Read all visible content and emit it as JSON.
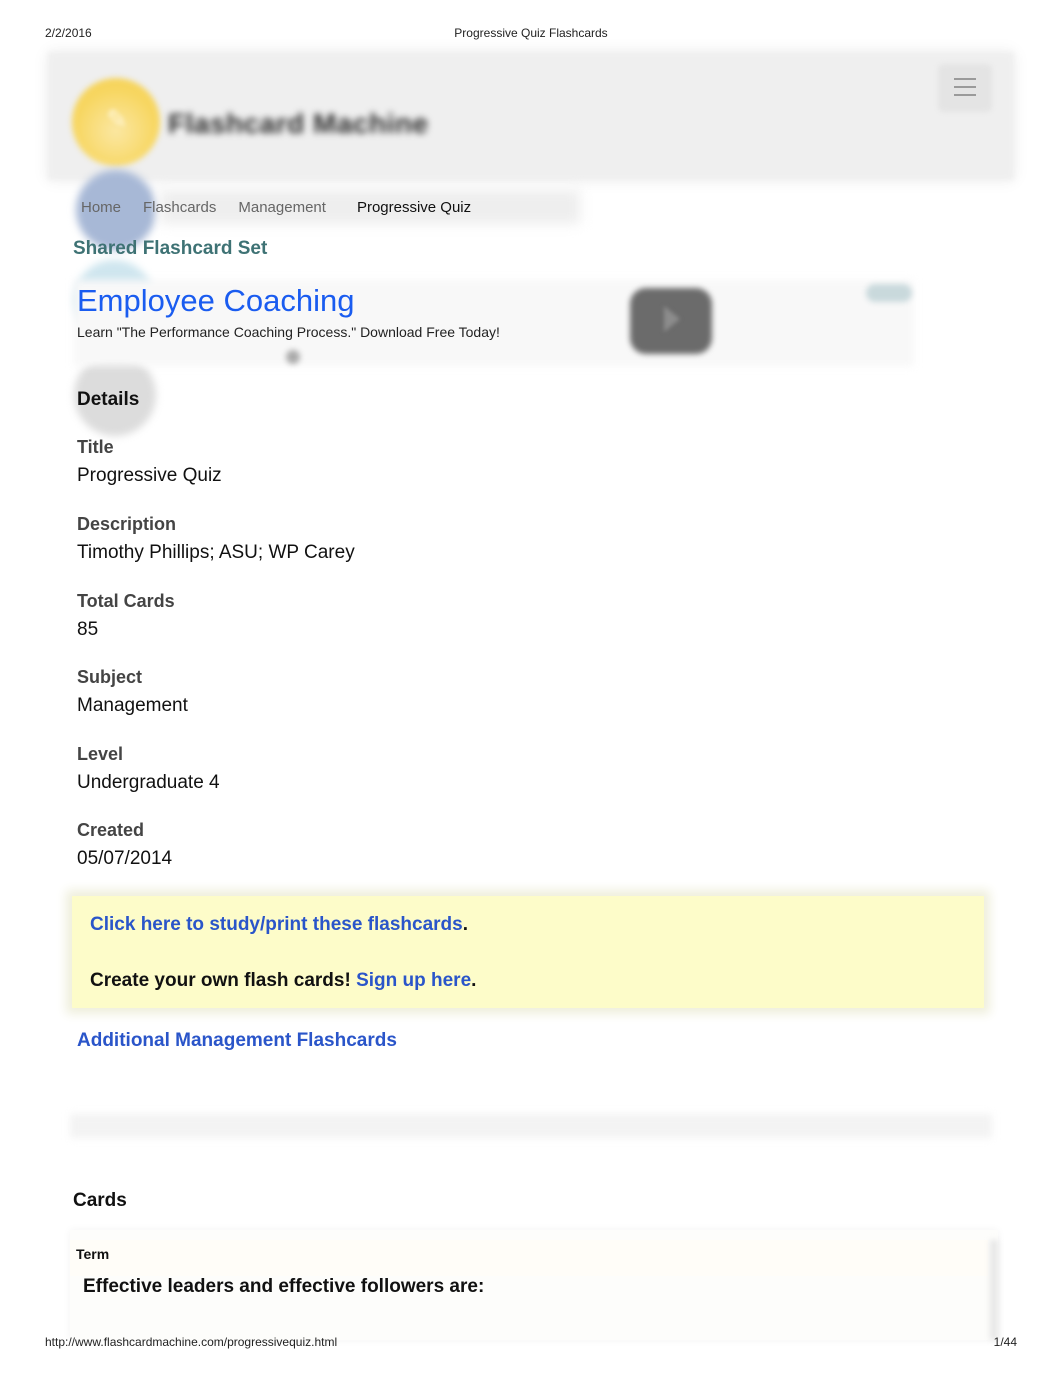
{
  "print": {
    "date": "2/2/2016",
    "doc_title": "Progressive Quiz Flashcards",
    "url": "http://www.flashcardmachine.com/progressivequiz.html",
    "page": "1/44"
  },
  "header": {
    "brand": "Flashcard Machine",
    "logo_icon": "pencil-icon",
    "menu_icon": "hamburger-menu-icon"
  },
  "breadcrumb": [
    {
      "label": "Home"
    },
    {
      "label": "Flashcards"
    },
    {
      "label": "Management"
    },
    {
      "label": "Progressive Quiz"
    }
  ],
  "section_label": "Shared Flashcard Set",
  "ad": {
    "title": "Employee Coaching",
    "text": "Learn \"The Performance Coaching Process.\" Download Free Today!",
    "play_icon": "play-icon",
    "title_color": "#1a5cf0"
  },
  "details": {
    "heading": "Details",
    "fields": [
      {
        "label": "Title",
        "value": "Progressive Quiz"
      },
      {
        "label": "Description",
        "value": "Timothy Phillips; ASU; WP Carey"
      },
      {
        "label": "Total Cards",
        "value": "85"
      },
      {
        "label": "Subject",
        "value": "Management"
      },
      {
        "label": "Level",
        "value": "Undergraduate 4"
      },
      {
        "label": "Created",
        "value": "05/07/2014"
      }
    ]
  },
  "callout": {
    "study_link": "Click here to study/print these flashcards",
    "study_suffix": ".",
    "create_text": "Create your own flash cards!",
    "signup_link": "Sign up here",
    "signup_suffix": ".",
    "background": "#fdfcc9",
    "link_color": "#2a55c9"
  },
  "additional_link": "Additional Management Flashcards",
  "cards": {
    "heading": "Cards",
    "items": [
      {
        "term_label": "Term",
        "term": "Effective leaders and effective followers are:"
      }
    ]
  },
  "colors": {
    "section_label": "#3e7274",
    "logo": "#f7d660"
  }
}
